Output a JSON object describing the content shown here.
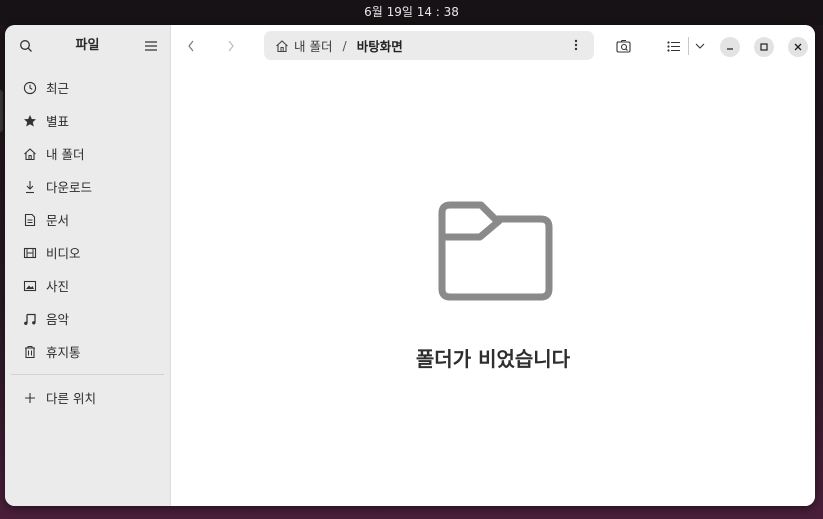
{
  "topbar": {
    "clock": "6월 19일 14 : 38"
  },
  "sidebar": {
    "title": "파일",
    "items": [
      {
        "label": "최근",
        "icon": "clock-icon"
      },
      {
        "label": "별표",
        "icon": "star-icon"
      },
      {
        "label": "내 폴더",
        "icon": "home-icon"
      },
      {
        "label": "다운로드",
        "icon": "download-icon"
      },
      {
        "label": "문서",
        "icon": "document-icon"
      },
      {
        "label": "비디오",
        "icon": "video-icon"
      },
      {
        "label": "사진",
        "icon": "picture-icon"
      },
      {
        "label": "음악",
        "icon": "music-icon"
      },
      {
        "label": "휴지통",
        "icon": "trash-icon"
      }
    ],
    "other_locations": {
      "label": "다른 위치",
      "icon": "plus-icon"
    }
  },
  "pathbar": {
    "home": "내 폴더",
    "separator": "/",
    "current": "바탕화면"
  },
  "empty_state": {
    "message": "폴더가 비었습니다"
  }
}
